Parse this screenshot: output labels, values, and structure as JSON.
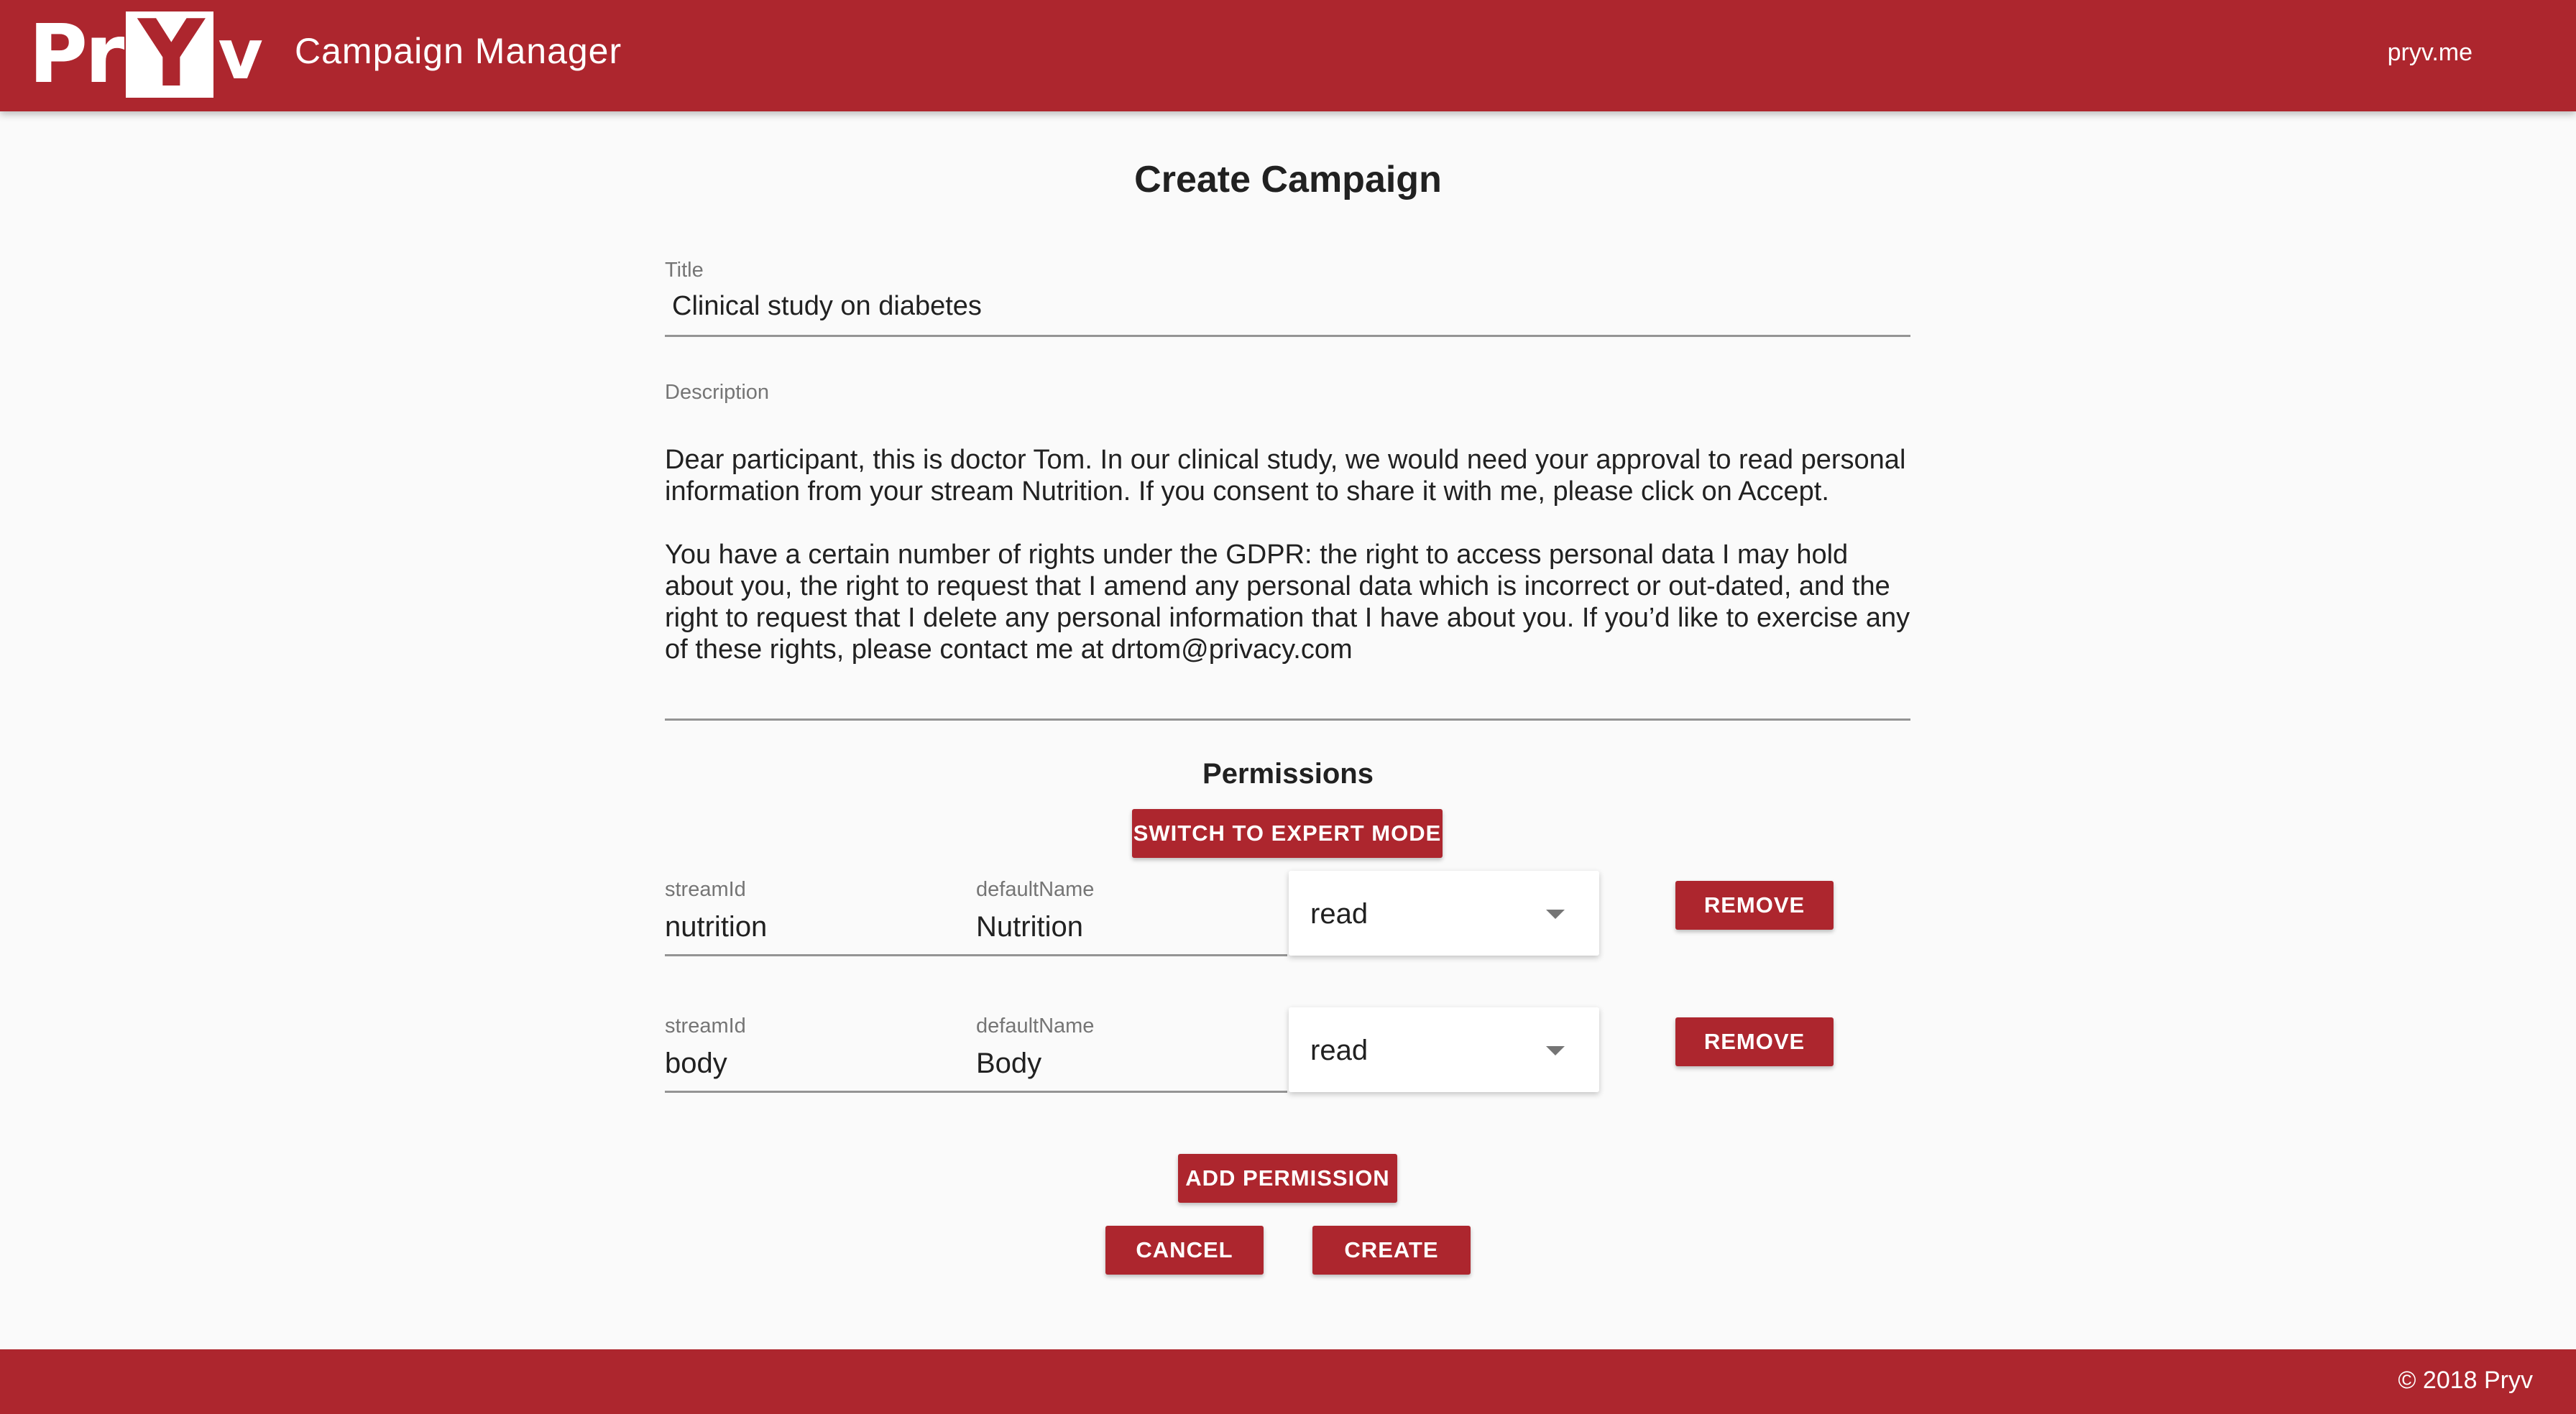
{
  "header": {
    "logo_pre": "Pr",
    "logo_box": "Y",
    "logo_post": "v",
    "app_title": "Campaign Manager",
    "domain": "pryv.me",
    "brand_color": "#ad262e"
  },
  "page": {
    "title": "Create Campaign"
  },
  "form": {
    "title_label": "Title",
    "title_value": "Clinical study on diabetes",
    "description_label": "Description",
    "description_value": "Dear participant, this is doctor Tom. In our clinical study, we would need your approval to read personal information from your stream Nutrition. If you consent to share it with me, please click on Accept.\n\nYou have a certain number of rights under the GDPR: the right to access personal data I may hold about you, the right to request that I amend any personal data which is incorrect or out-dated, and the right to request that I delete any personal information that I have about you. If you’d like to exercise any of these rights, please contact me at drtom@privacy.com"
  },
  "permissions": {
    "section_title": "Permissions",
    "expert_mode_label": "SWITCH TO EXPERT MODE",
    "rows": [
      {
        "stream_id_label": "streamId",
        "stream_id": "nutrition",
        "default_name_label": "defaultName",
        "default_name": "Nutrition",
        "level": "read",
        "remove_label": "REMOVE"
      },
      {
        "stream_id_label": "streamId",
        "stream_id": "body",
        "default_name_label": "defaultName",
        "default_name": "Body",
        "level": "read",
        "remove_label": "REMOVE"
      }
    ],
    "add_label": "ADD PERMISSION"
  },
  "actions": {
    "cancel_label": "CANCEL",
    "create_label": "CREATE"
  },
  "footer": {
    "copyright": "© 2018 Pryv"
  }
}
